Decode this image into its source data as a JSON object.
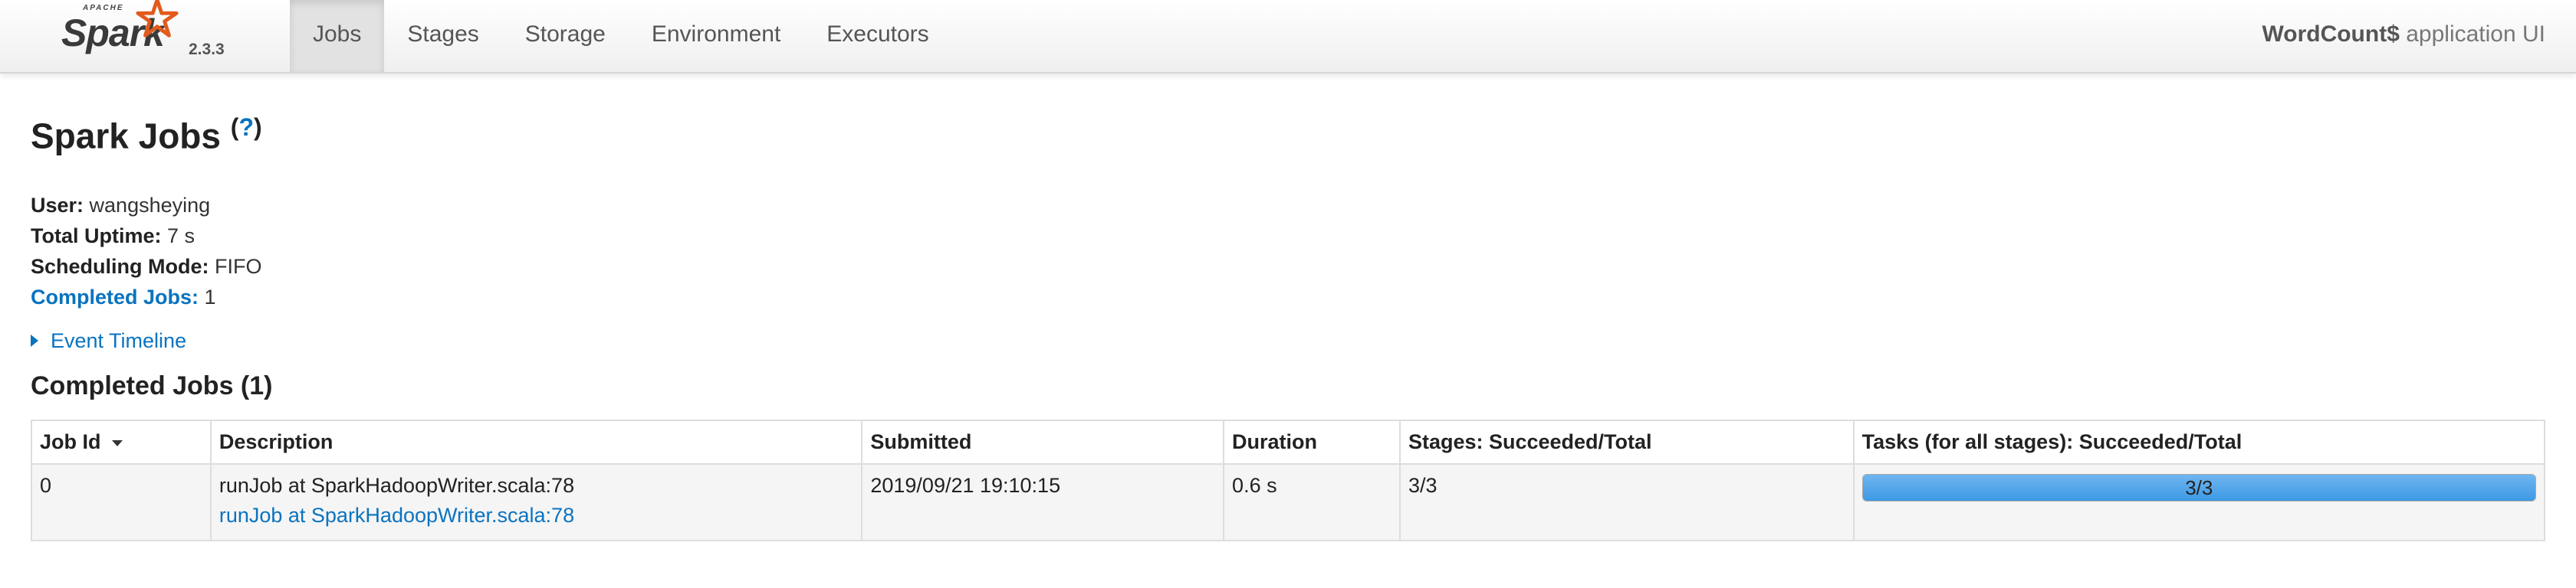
{
  "brand": {
    "apache": "APACHE",
    "name": "Spark",
    "version": "2.3.3"
  },
  "nav": {
    "tabs": [
      {
        "label": "Jobs",
        "active": true
      },
      {
        "label": "Stages",
        "active": false
      },
      {
        "label": "Storage",
        "active": false
      },
      {
        "label": "Environment",
        "active": false
      },
      {
        "label": "Executors",
        "active": false
      }
    ],
    "app_name": "WordCount$",
    "app_suffix": " application UI"
  },
  "page": {
    "title": "Spark Jobs",
    "help": "?"
  },
  "summary": {
    "user_label": "User:",
    "user_value": " wangsheying",
    "uptime_label": "Total Uptime:",
    "uptime_value": " 7 s",
    "mode_label": "Scheduling Mode:",
    "mode_value": " FIFO",
    "completed_label": "Completed Jobs:",
    "completed_value": " 1"
  },
  "event_timeline": "Event Timeline",
  "completed_section": {
    "title": "Completed Jobs (1)"
  },
  "table": {
    "headers": [
      "Job Id",
      "Description",
      "Submitted",
      "Duration",
      "Stages: Succeeded/Total",
      "Tasks (for all stages): Succeeded/Total"
    ],
    "rows": [
      {
        "job_id": "0",
        "description": "runJob at SparkHadoopWriter.scala:78",
        "description_link": "runJob at SparkHadoopWriter.scala:78",
        "submitted": "2019/09/21 19:10:15",
        "duration": "0.6 s",
        "stages": "3/3",
        "tasks": "3/3",
        "tasks_progress": 1.0
      }
    ]
  },
  "colors": {
    "link": "#0a73c0",
    "progress": "#3d99e4",
    "spark_star": "#e25a1c"
  },
  "icons": {
    "sort": "sort-descending-icon",
    "expand": "caret-right-icon",
    "logo": "spark-star-icon"
  }
}
